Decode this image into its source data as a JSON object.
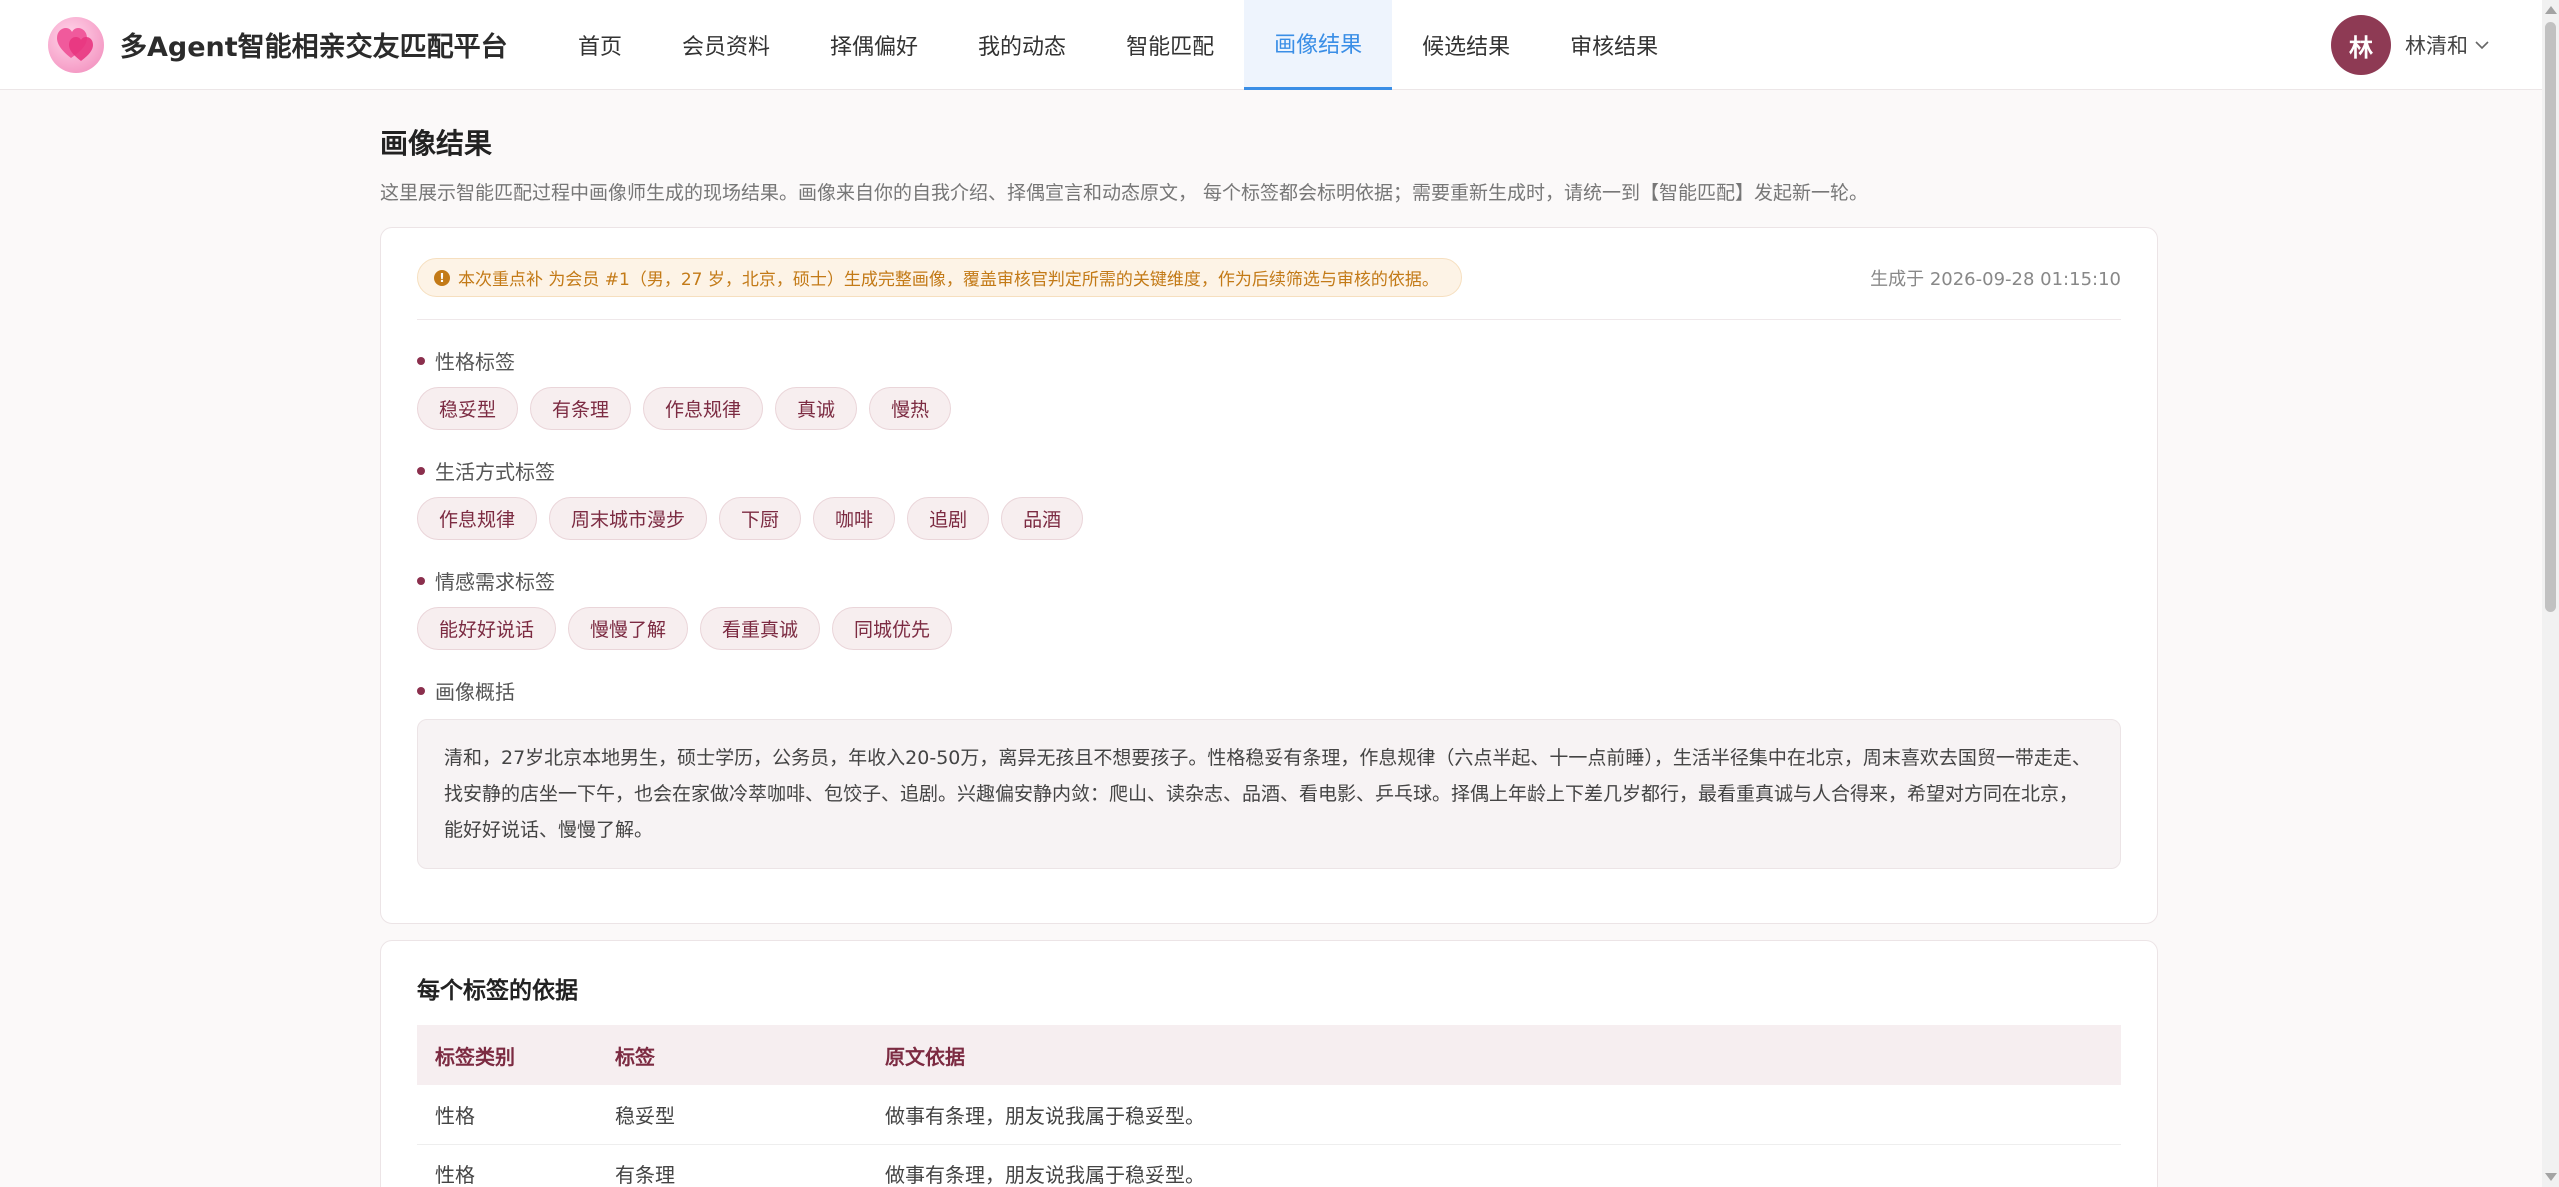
{
  "app": {
    "title": "多Agent智能相亲交友匹配平台"
  },
  "nav": {
    "items": [
      {
        "label": "首页"
      },
      {
        "label": "会员资料"
      },
      {
        "label": "择偶偏好"
      },
      {
        "label": "我的动态"
      },
      {
        "label": "智能匹配"
      },
      {
        "label": "画像结果",
        "active": true
      },
      {
        "label": "候选结果"
      },
      {
        "label": "审核结果"
      }
    ]
  },
  "user": {
    "avatar_char": "林",
    "name": "林清和"
  },
  "page": {
    "title": "画像结果",
    "description": "这里展示智能匹配过程中画像师生成的现场结果。画像来自你的自我介绍、择偶宣言和动态原文， 每个标签都会标明依据；需要重新生成时，请统一到【智能匹配】发起新一轮。"
  },
  "profile_card": {
    "notice": "本次重点补 为会员 #1（男，27 岁，北京，硕士）生成完整画像，覆盖审核官判定所需的关键维度，作为后续筛选与审核的依据。",
    "generated_time": "生成于 2026-09-28 01:15:10",
    "personality": {
      "label": "性格标签",
      "tags": [
        "稳妥型",
        "有条理",
        "作息规律",
        "真诚",
        "慢热"
      ]
    },
    "lifestyle": {
      "label": "生活方式标签",
      "tags": [
        "作息规律",
        "周末城市漫步",
        "下厨",
        "咖啡",
        "追剧",
        "品酒"
      ]
    },
    "emotional": {
      "label": "情感需求标签",
      "tags": [
        "能好好说话",
        "慢慢了解",
        "看重真诚",
        "同城优先"
      ]
    },
    "summary": {
      "label": "画像概括",
      "text": "清和，27岁北京本地男生，硕士学历，公务员，年收入20-50万，离异无孩且不想要孩子。性格稳妥有条理，作息规律（六点半起、十一点前睡），生活半径集中在北京，周末喜欢去国贸一带走走、找安静的店坐一下午，也会在家做冷萃咖啡、包饺子、追剧。兴趣偏安静内敛：爬山、读杂志、品酒、看电影、乒乓球。择偶上年龄上下差几岁都行，最看重真诚与人合得来，希望对方同在北京，能好好说话、慢慢了解。"
    }
  },
  "basis_card": {
    "title": "每个标签的依据",
    "headers": [
      "标签类别",
      "标签",
      "原文依据"
    ],
    "rows": [
      [
        "性格",
        "稳妥型",
        "做事有条理，朋友说我属于稳妥型。"
      ],
      [
        "性格",
        "有条理",
        "做事有条理，朋友说我属于稳妥型。"
      ]
    ]
  },
  "colors": {
    "accent": "#3a8ee6",
    "brand": "#8e3a54",
    "tag_text": "#7c2b42",
    "notice": "#c37a17"
  }
}
